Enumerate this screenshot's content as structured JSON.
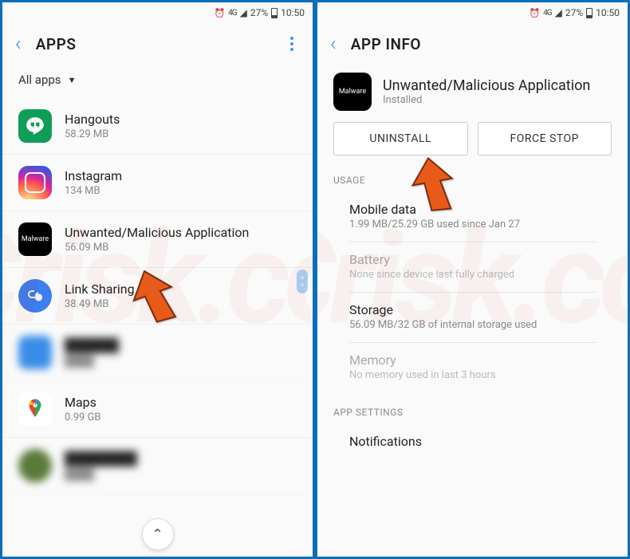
{
  "status_bar": {
    "network": "4G",
    "signal": "◢",
    "battery_pct": "27%",
    "time": "10:50"
  },
  "left": {
    "title": "APPS",
    "filter": "All apps",
    "apps": [
      {
        "name": "Hangouts",
        "size": "58.29 MB",
        "icon": "hangouts"
      },
      {
        "name": "Instagram",
        "size": "134 MB",
        "icon": "instagram"
      },
      {
        "name": "Unwanted/Malicious Application",
        "size": "56.09 MB",
        "icon": "malware",
        "icon_label": "Malware"
      },
      {
        "name": "Link Sharing",
        "size": "38.49 MB",
        "icon": "linkshare"
      },
      {
        "name": "—",
        "size": "—",
        "icon": "blur1",
        "blurred": true
      },
      {
        "name": "Maps",
        "size": "0.99 GB",
        "icon": "maps"
      },
      {
        "name": "—",
        "size": "—",
        "icon": "blur2",
        "blurred": true
      }
    ]
  },
  "right": {
    "title": "APP INFO",
    "app_name": "Unwanted/Malicious Application",
    "app_status": "Installed",
    "icon_label": "Malware",
    "buttons": {
      "uninstall": "UNINSTALL",
      "force_stop": "FORCE STOP"
    },
    "section_usage": "USAGE",
    "usage": [
      {
        "title": "Mobile data",
        "sub": "1.99 MB/25.29 GB used since Jan 27",
        "dim": false
      },
      {
        "title": "Battery",
        "sub": "None since device last fully charged",
        "dim": true
      },
      {
        "title": "Storage",
        "sub": "56.09 MB/32 GB of internal storage used",
        "dim": false
      },
      {
        "title": "Memory",
        "sub": "No memory used in last 3 hours",
        "dim": true
      }
    ],
    "section_settings": "APP SETTINGS",
    "settings_first": "Notifications"
  },
  "watermark": "PCrisk.com"
}
